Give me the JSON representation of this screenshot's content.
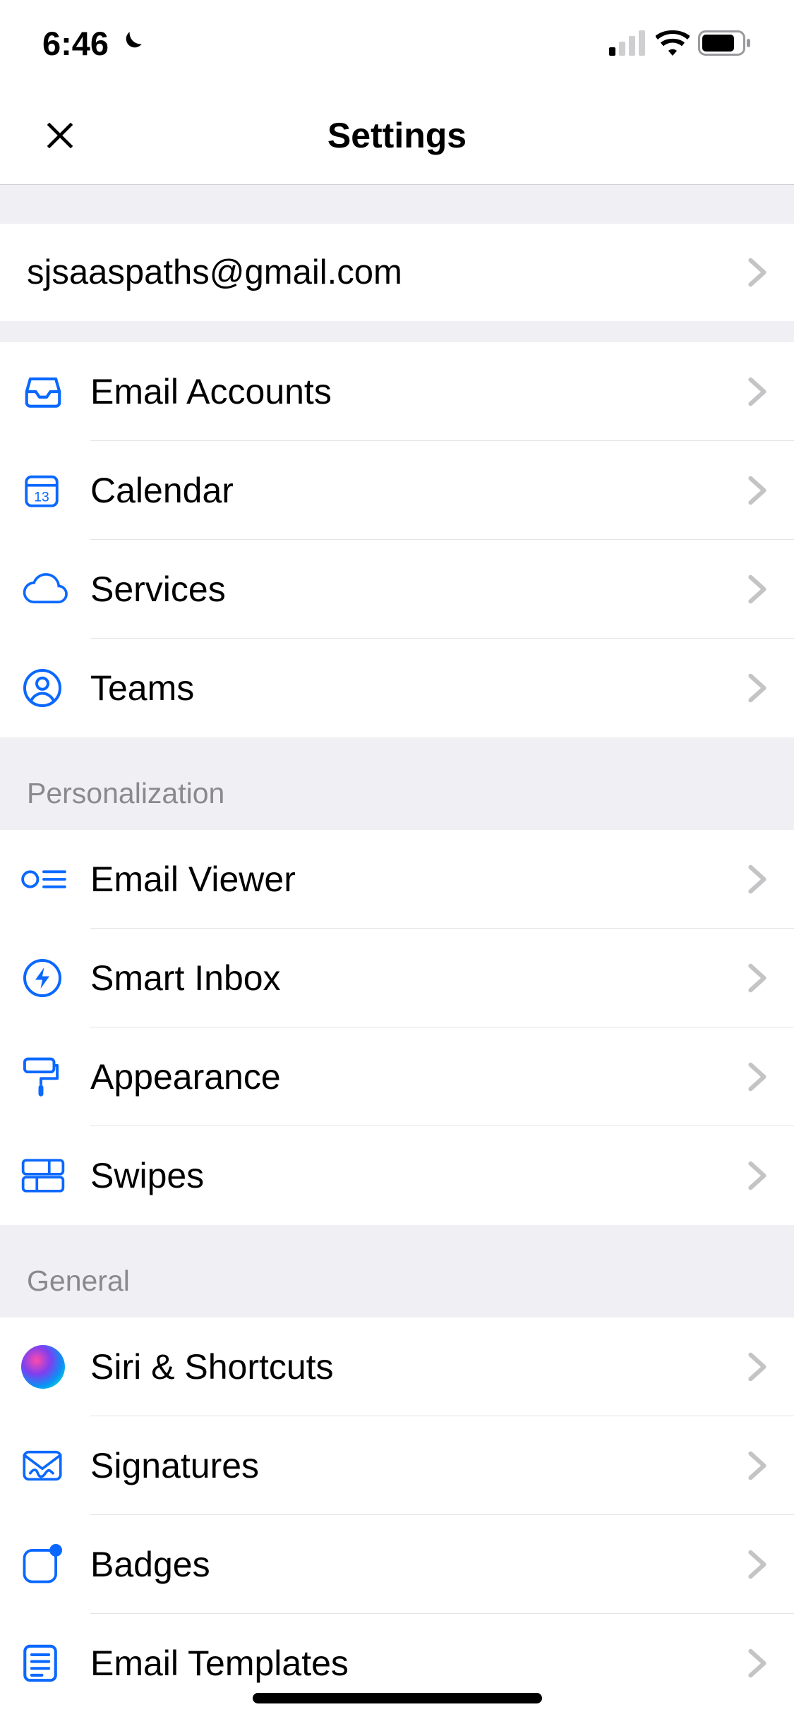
{
  "status": {
    "time": "6:46"
  },
  "nav": {
    "title": "Settings"
  },
  "account": {
    "email": "sjsaaspaths@gmail.com"
  },
  "mainItems": [
    {
      "label": "Email Accounts"
    },
    {
      "label": "Calendar"
    },
    {
      "label": "Services"
    },
    {
      "label": "Teams"
    }
  ],
  "personalizationHeader": "Personalization",
  "personalizationItems": [
    {
      "label": "Email Viewer"
    },
    {
      "label": "Smart Inbox"
    },
    {
      "label": "Appearance"
    },
    {
      "label": "Swipes"
    }
  ],
  "generalHeader": "General",
  "generalItems": [
    {
      "label": "Siri & Shortcuts"
    },
    {
      "label": "Signatures"
    },
    {
      "label": "Badges"
    },
    {
      "label": "Email Templates"
    }
  ]
}
